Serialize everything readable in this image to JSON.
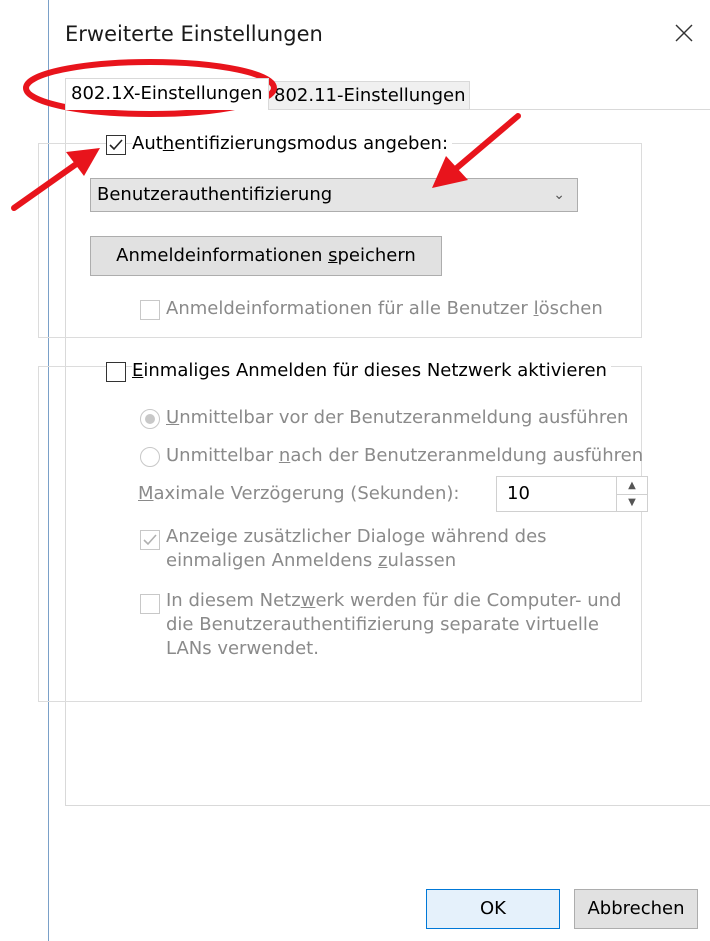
{
  "window": {
    "title": "Erweiterte Einstellungen"
  },
  "tabs": [
    {
      "label": "802.1X-Einstellungen",
      "active": true
    },
    {
      "label": "802.11-Einstellungen",
      "active": false
    }
  ],
  "auth_section": {
    "checkbox_label_pre": "Aut",
    "checkbox_label_u": "h",
    "checkbox_label_post": "entifizierungsmodus angeben:",
    "checked": true,
    "select_value": "Benutzerauthentifizierung",
    "save_btn_pre": "Anmeldeinformationen ",
    "save_btn_u": "s",
    "save_btn_post": "peichern",
    "delete_label_pre": "Anmeldeinformationen für alle Benutzer ",
    "delete_label_u": "l",
    "delete_label_post": "öschen"
  },
  "sso_section": {
    "checkbox_label_u": "E",
    "checkbox_label_post": "inmaliges Anmelden für dieses Netzwerk aktivieren",
    "radio1_u": "U",
    "radio1_post": "nmittelbar vor der Benutzeranmeldung ausführen",
    "radio2_pre": "Unmittelbar ",
    "radio2_u": "n",
    "radio2_post": "ach der Benutzeranmeldung ausführen",
    "delay_u": "M",
    "delay_post": "aximale Verzögerung (Sekunden):",
    "delay_value": "10",
    "dialogs_line1": "Anzeige zusätzlicher Dialoge während des",
    "dialogs_line2_pre": "einmaligen Anmeldens ",
    "dialogs_line2_u": "z",
    "dialogs_line2_post": "ulassen",
    "vlan_line1_pre": "In diesem Netz",
    "vlan_line1_u": "w",
    "vlan_line1_post": "erk werden für die Computer- und",
    "vlan_line2": "die Benutzerauthentifizierung separate virtuelle",
    "vlan_line3": "LANs verwendet."
  },
  "buttons": {
    "ok": "OK",
    "cancel": "Abbrechen"
  },
  "colors": {
    "annotation": "#e8141c",
    "accent": "#0078d7"
  },
  "icons": {
    "close": "close-icon",
    "dropdown": "chevron-down-icon"
  }
}
